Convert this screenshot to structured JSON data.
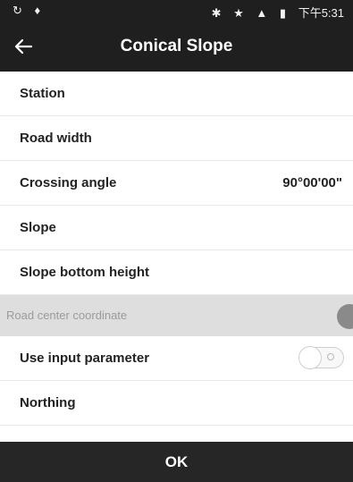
{
  "status_bar": {
    "left_icons": [
      "sync-icon",
      "usb-icon"
    ],
    "right_icons": [
      "bluetooth-icon",
      "star-icon",
      "signal-icon",
      "battery-icon"
    ],
    "left_symbols": [
      "↻",
      "♦"
    ],
    "right_symbols": [
      "✱",
      "★",
      "▲",
      "▮"
    ],
    "time": "下午5:31"
  },
  "app_bar": {
    "back_icon": "arrow-left-icon",
    "title": "Conical Slope"
  },
  "rows": [
    {
      "label": "Station",
      "value": ""
    },
    {
      "label": "Road width",
      "value": ""
    },
    {
      "label": "Crossing angle",
      "value": "90°00'00\""
    },
    {
      "label": "Slope",
      "value": ""
    },
    {
      "label": "Slope bottom height",
      "value": ""
    }
  ],
  "section": {
    "label": "Road center coordinate"
  },
  "toggle_row": {
    "label": "Use input parameter",
    "toggle_state": "off"
  },
  "last_row": {
    "label": "Northing"
  },
  "footer": {
    "ok_label": "OK"
  },
  "colors": {
    "header_bg": "#1f1f1f",
    "footer_bg": "#262626",
    "section_bg": "#dedede"
  }
}
